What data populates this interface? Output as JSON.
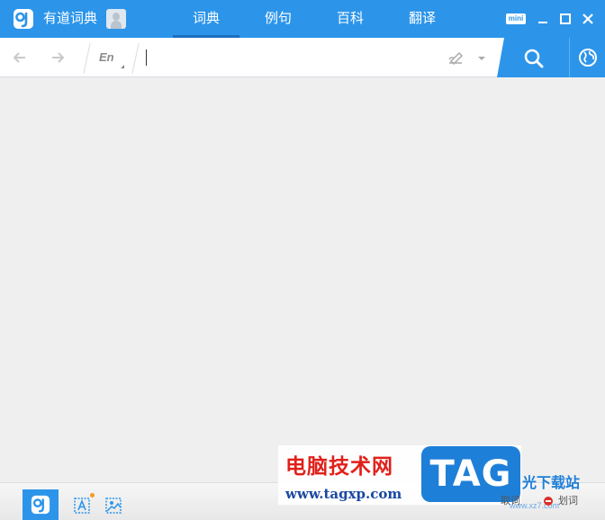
{
  "app": {
    "title": "有道词典"
  },
  "tabs": [
    {
      "label": "词典",
      "active": true
    },
    {
      "label": "例句",
      "active": false
    },
    {
      "label": "百科",
      "active": false
    },
    {
      "label": "翻译",
      "active": false
    }
  ],
  "window_controls": {
    "mini_label": "mini"
  },
  "search": {
    "language": "En",
    "value": "",
    "placeholder": ""
  },
  "bottom_bar": {
    "word_capture_label": "划词",
    "other_label": "取词"
  },
  "watermark": {
    "title": "电脑技术网",
    "url": "www.tagxp.com",
    "badge": "TAG",
    "site_label": "光下载站",
    "site_url": "www.xz7.com"
  },
  "colors": {
    "brand_blue": "#2c95ea",
    "tab_underline": "#1b6fc0",
    "content_bg": "#efefef"
  },
  "icons": [
    "youdao-logo-icon",
    "avatar-icon",
    "back-arrow-icon",
    "forward-arrow-icon",
    "handwriting-icon",
    "search-icon",
    "globe-icon",
    "minimize-icon",
    "maximize-icon",
    "close-icon",
    "text-icon",
    "image-icon",
    "stop-icon"
  ]
}
